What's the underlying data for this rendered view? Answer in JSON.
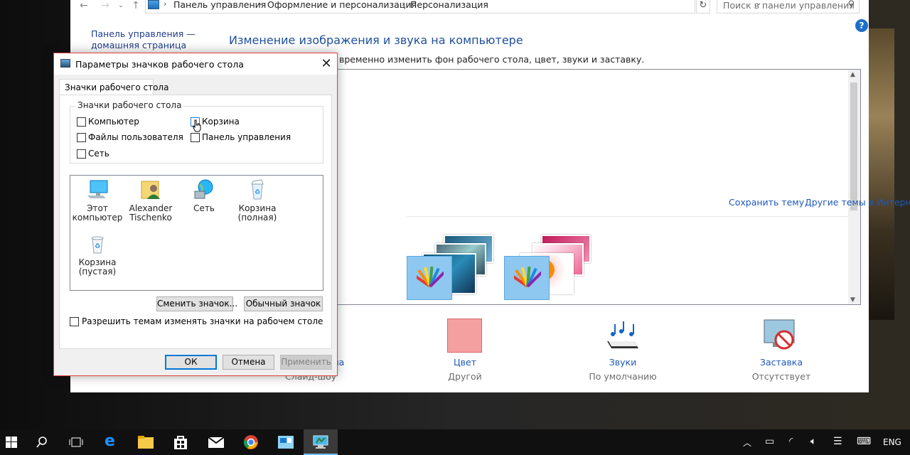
{
  "address_bar": {
    "crumbs": [
      "Панель управления",
      "Оформление и персонализация",
      "Персонализация"
    ],
    "search_placeholder": "Поиск в панели управления"
  },
  "sidebar": {
    "home_link": "Панель управления — домашняя страница"
  },
  "main": {
    "heading": "Изменение изображения и звука на компьютере",
    "subtext": "временно изменить фон рабочего стола, цвет, звуки и заставку.",
    "save_theme": "Сохранить тему",
    "more_themes": "Другие темы в Интернете"
  },
  "bottom_items": [
    {
      "label": "ала",
      "sub": "Слайд-шоу"
    },
    {
      "label": "Цвет",
      "sub": "Другой"
    },
    {
      "label": "Звуки",
      "sub": "По умолчанию"
    },
    {
      "label": "Заставка",
      "sub": "Отсутствует"
    }
  ],
  "dialog": {
    "title": "Параметры значков рабочего стола",
    "tab": "Значки рабочего стола",
    "group_title": "Значки рабочего стола",
    "checkboxes": [
      {
        "label": "Компьютер",
        "checked": false
      },
      {
        "label": "Корзина",
        "checked": false
      },
      {
        "label": "Файлы пользователя",
        "checked": false
      },
      {
        "label": "Панель управления",
        "checked": false
      },
      {
        "label": "Сеть",
        "checked": false
      }
    ],
    "icons": [
      {
        "line1": "Этот",
        "line2": "компьютер",
        "icon": "computer-icon"
      },
      {
        "line1": "Alexander",
        "line2": "Tischenko",
        "icon": "user-folder-icon"
      },
      {
        "line1": "Сеть",
        "line2": "",
        "icon": "network-icon"
      },
      {
        "line1": "Корзина",
        "line2": "(полная)",
        "icon": "recycle-bin-full-icon"
      },
      {
        "line1": "Корзина",
        "line2": "(пустая)",
        "icon": "recycle-bin-empty-icon"
      }
    ],
    "change_icon_btn": "Сменить значок...",
    "default_icon_btn": "Обычный значок",
    "allow_themes": "Разрешить темам изменять значки на рабочем столе",
    "ok": "ОК",
    "cancel": "Отмена",
    "apply": "Применить"
  },
  "taskbar": {
    "language": "ENG"
  },
  "colors": {
    "accent": "#0078d7",
    "link": "#1e58b8",
    "dialog_border": "#e04343",
    "color_swatch": "#f5a0a0"
  }
}
